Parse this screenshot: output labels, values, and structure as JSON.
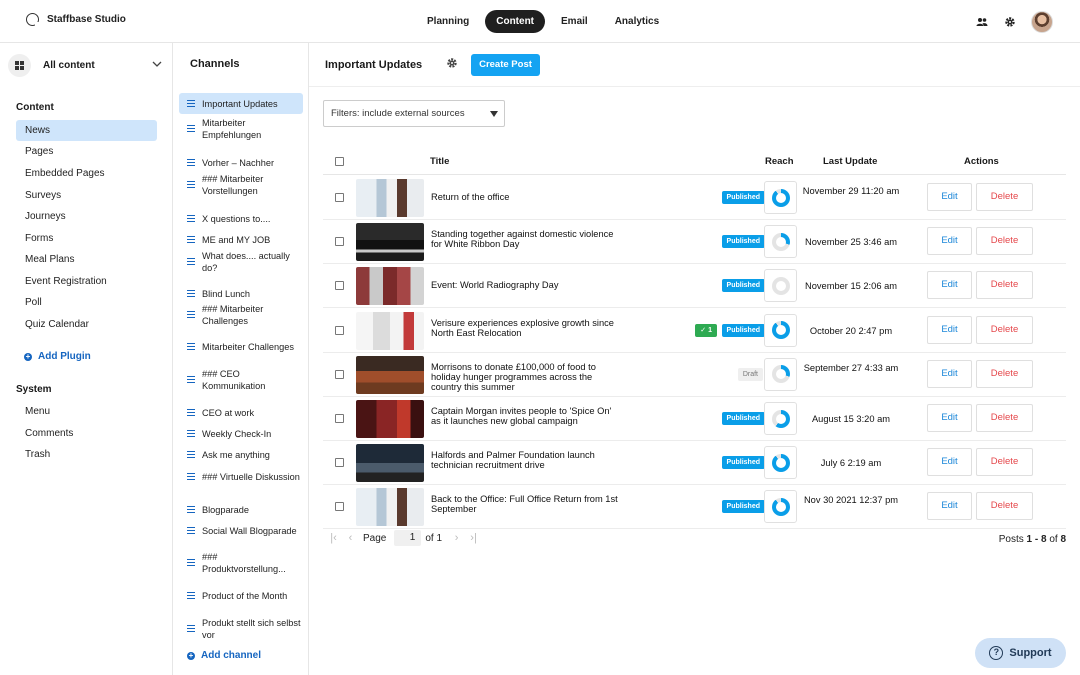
{
  "app": {
    "name": "Staffbase Studio"
  },
  "topnav": {
    "tabs": [
      {
        "label": "Planning",
        "active": false
      },
      {
        "label": "Content",
        "active": true
      },
      {
        "label": "Email",
        "active": false
      },
      {
        "label": "Analytics",
        "active": false
      }
    ]
  },
  "sidebar": {
    "select_label": "All content",
    "content_heading": "Content",
    "content_items": [
      "News",
      "Pages",
      "Embedded Pages",
      "Surveys",
      "Journeys",
      "Forms",
      "Meal Plans",
      "Event Registration",
      "Poll",
      "Quiz Calendar"
    ],
    "add_plugin": "Add Plugin",
    "system_heading": "System",
    "system_items": [
      "Menu",
      "Comments",
      "Trash"
    ]
  },
  "channels": {
    "title": "Channels",
    "items": [
      "Important Updates",
      "Mitarbeiter Empfehlungen",
      "Vorher – Nachher",
      "### Mitarbeiter Vorstellungen",
      "X questions to....",
      "ME and MY JOB",
      "What does.... actually do?",
      "Blind Lunch",
      "### Mitarbeiter Challenges",
      "Mitarbeiter Challenges",
      "### CEO Kommunikation",
      "CEO at work",
      "Weekly Check-In",
      "Ask me anything",
      "### Virtuelle Diskussion",
      "Blogparade",
      "Social Wall Blogparade",
      "### Produktvorstellung...",
      "Product of the Month",
      "Produkt stellt sich selbst vor"
    ],
    "add_channel": "Add channel"
  },
  "main": {
    "title": "Important Updates",
    "create_button": "Create Post",
    "filter_label": "Filters: include external sources",
    "columns": {
      "title": "Title",
      "reach": "Reach",
      "last_update": "Last Update",
      "actions": "Actions"
    },
    "edit_label": "Edit",
    "delete_label": "Delete",
    "posts": [
      {
        "title": "Return of the office",
        "status": "Published",
        "reach": 0.9,
        "last_update": "November 29 11:20 am",
        "check": ""
      },
      {
        "title": "Standing together against domestic violence for White Ribbon Day",
        "status": "Published",
        "reach": 0.3,
        "last_update": "November 25 3:46 am",
        "check": ""
      },
      {
        "title": "Event: World Radiography Day",
        "status": "Published",
        "reach": 0.0,
        "last_update": "November 15 2:06 am",
        "check": ""
      },
      {
        "title": "Verisure experiences explosive growth since North East Relocation",
        "status": "Published",
        "reach": 0.9,
        "last_update": "October 20 2:47 pm",
        "check": "✓ 1"
      },
      {
        "title": "Morrisons to donate £100,000 of food to holiday hunger programmes across the country this summer",
        "status": "Draft",
        "reach": 0.3,
        "last_update": "September 27 4:33 am",
        "check": ""
      },
      {
        "title": "Captain Morgan invites people to 'Spice On' as it launches new global campaign",
        "status": "Published",
        "reach": 0.6,
        "last_update": "August 15 3:20 am",
        "check": ""
      },
      {
        "title": "Halfords and Palmer Foundation launch technician recruitment drive",
        "status": "Published",
        "reach": 0.9,
        "last_update": "July 6 2:19 am",
        "check": ""
      },
      {
        "title": "Back to the Office: Full Office Return from 1st September",
        "status": "Published",
        "reach": 0.9,
        "last_update": "Nov 30 2021 12:37 pm",
        "check": ""
      }
    ],
    "pagination": {
      "page_label": "Page",
      "page": "1",
      "of_label": "of 1",
      "posts_prefix": "Posts",
      "range": "1 - 8",
      "of": "of",
      "total": "8"
    }
  },
  "support": {
    "label": "Support"
  },
  "colors": {
    "accent": "#14a3f2",
    "published": "#0a9ee8",
    "active_bg": "#cfe5fb",
    "delete": "#e5474b",
    "link": "#1565c0"
  }
}
